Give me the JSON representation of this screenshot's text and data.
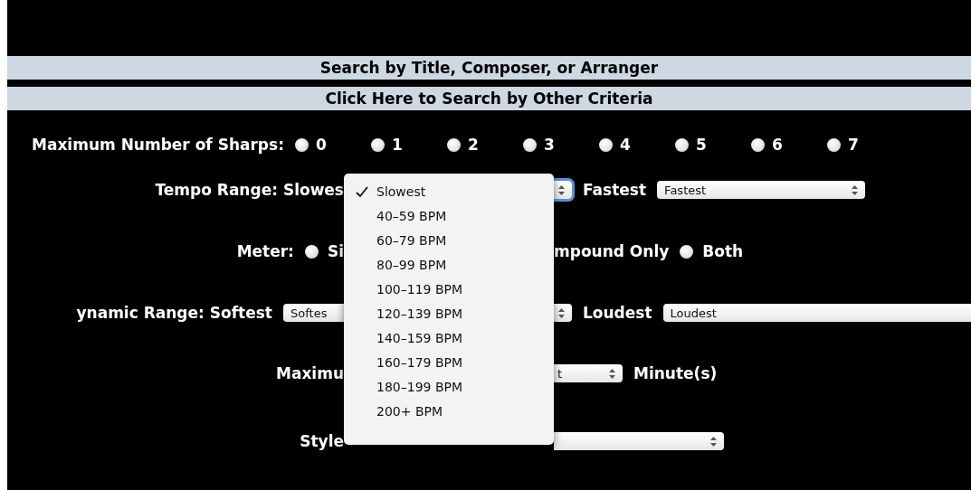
{
  "header": {
    "title_bar": "Search by Title, Composer, or Arranger",
    "link_bar": "Click Here to Search by Other Criteria"
  },
  "sharps": {
    "label": "Maximum Number of Sharps:",
    "options": [
      {
        "label": "0",
        "selected": false
      },
      {
        "label": "1",
        "selected": false
      },
      {
        "label": "2",
        "selected": false
      },
      {
        "label": "3",
        "selected": false
      },
      {
        "label": "4",
        "selected": false
      },
      {
        "label": "5",
        "selected": false
      },
      {
        "label": "6",
        "selected": false
      },
      {
        "label": "7",
        "selected": false
      }
    ]
  },
  "rows": [
    {
      "left": [
        {
          "kind": "text",
          "text": "Tempo Range: Slowes"
        }
      ],
      "right": [
        {
          "kind": "select",
          "clipped_left": true,
          "clipped_right": false,
          "focused": true
        },
        {
          "kind": "text",
          "text": "Fastest"
        },
        {
          "kind": "select",
          "clipped_left": false,
          "clipped_right": false,
          "focused": false,
          "value": "Fastest"
        }
      ]
    },
    {
      "left": [
        {
          "kind": "text",
          "text": "Meter:"
        },
        {
          "kind": "radio",
          "label": "Si",
          "selected": false
        }
      ],
      "right": [
        {
          "kind": "text",
          "text": "mpound Only"
        },
        {
          "kind": "radio",
          "label": "Both",
          "selected": false
        }
      ]
    },
    {
      "left": [
        {
          "kind": "text",
          "text": "ynamic Range: Softest"
        },
        {
          "kind": "select",
          "clipped_left": false,
          "clipped_right": true,
          "focused": false,
          "value": "Softes"
        }
      ],
      "right": [
        {
          "kind": "select",
          "clipped_left": true,
          "clipped_right": false,
          "focused": false
        },
        {
          "kind": "text",
          "text": "Loudest"
        },
        {
          "kind": "select",
          "clipped_left": false,
          "clipped_right": true,
          "focused": false,
          "value": "Loudest"
        }
      ]
    },
    {
      "left": [
        {
          "kind": "text",
          "text": "Maximu"
        }
      ],
      "right": [
        {
          "kind": "select",
          "clipped_left": true,
          "clipped_right": false,
          "focused": false,
          "value": "t"
        },
        {
          "kind": "text",
          "text": "Minute(s)"
        }
      ]
    },
    {
      "left": [
        {
          "kind": "text",
          "text": "Style"
        }
      ],
      "right": [
        {
          "kind": "select",
          "clipped_left": true,
          "clipped_right": false,
          "focused": false
        }
      ]
    }
  ],
  "menu": {
    "items": [
      {
        "label": "Slowest",
        "selected": true
      },
      {
        "label": "40–59 BPM",
        "selected": false
      },
      {
        "label": "60–79 BPM",
        "selected": false
      },
      {
        "label": "80–99 BPM",
        "selected": false
      },
      {
        "label": "100–119 BPM",
        "selected": false
      },
      {
        "label": "120–139 BPM",
        "selected": false
      },
      {
        "label": "140–159 BPM",
        "selected": false
      },
      {
        "label": "160–179 BPM",
        "selected": false
      },
      {
        "label": "180–199 BPM",
        "selected": false
      },
      {
        "label": "200+ BPM",
        "selected": false
      }
    ]
  }
}
